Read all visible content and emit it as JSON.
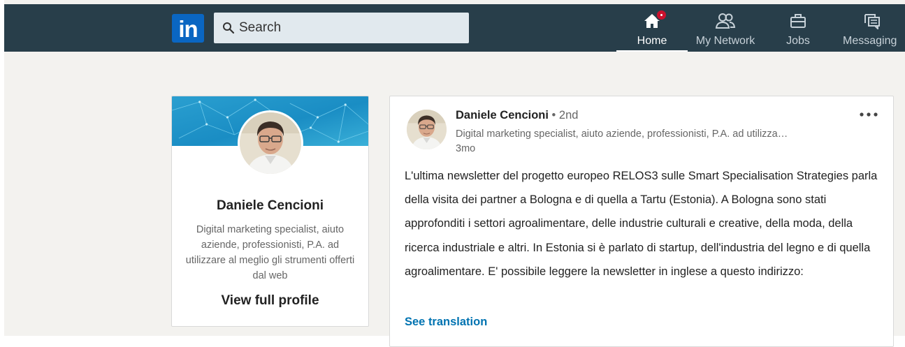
{
  "nav": {
    "logo_text": "in",
    "search_placeholder": "Search",
    "items": [
      {
        "label": "Home",
        "icon": "home-icon",
        "active": true,
        "notification": true
      },
      {
        "label": "My Network",
        "icon": "people-icon",
        "active": false
      },
      {
        "label": "Jobs",
        "icon": "briefcase-icon",
        "active": false
      },
      {
        "label": "Messaging",
        "icon": "messaging-icon",
        "active": false
      }
    ]
  },
  "profile": {
    "name": "Daniele Cencioni",
    "headline": "Digital marketing specialist, aiuto aziende, professionisti, P.A. ad utilizzare al meglio gli strumenti offerti dal web",
    "view_profile_label": "View full profile"
  },
  "post": {
    "author_name": "Daniele Cencioni",
    "separator": " • ",
    "connection_degree": "2nd",
    "author_headline": "Digital marketing specialist, aiuto aziende, professionisti, P.A. ad utilizza…",
    "time": "3mo",
    "body": "L'ultima newsletter del progetto europeo RELOS3 sulle Smart Specialisation Strategies parla della visita dei partner a Bologna e di quella a Tartu (Estonia). A Bologna sono stati approfonditi i settori agroalimentare, delle industrie culturali e creative, della moda, della ricerca industriale e altri. In Estonia si è parlato di startup, dell'industria del legno e di quella agroalimentare. E' possibile leggere la newsletter in inglese a questo indirizzo:",
    "translate_label": "See translation",
    "menu_icon": "more-options-icon"
  },
  "colors": {
    "nav_bg": "#283e4a",
    "brand_blue": "#0a66c2",
    "link_blue": "#0073b1",
    "notification_red": "#cb112d",
    "page_bg": "#f3f2ef"
  }
}
